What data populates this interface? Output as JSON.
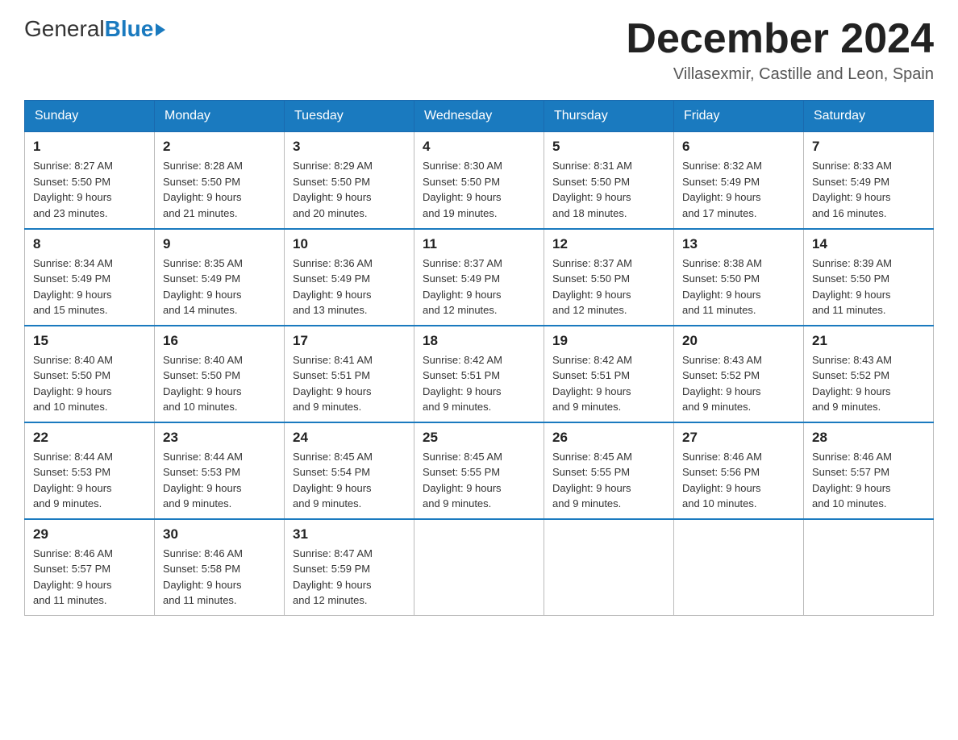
{
  "header": {
    "logo": {
      "general_text": "General",
      "blue_text": "Blue"
    },
    "title": "December 2024",
    "location": "Villasexmir, Castille and Leon, Spain"
  },
  "calendar": {
    "days_of_week": [
      "Sunday",
      "Monday",
      "Tuesday",
      "Wednesday",
      "Thursday",
      "Friday",
      "Saturday"
    ],
    "weeks": [
      [
        {
          "day": "1",
          "sunrise": "8:27 AM",
          "sunset": "5:50 PM",
          "daylight": "9 hours and 23 minutes."
        },
        {
          "day": "2",
          "sunrise": "8:28 AM",
          "sunset": "5:50 PM",
          "daylight": "9 hours and 21 minutes."
        },
        {
          "day": "3",
          "sunrise": "8:29 AM",
          "sunset": "5:50 PM",
          "daylight": "9 hours and 20 minutes."
        },
        {
          "day": "4",
          "sunrise": "8:30 AM",
          "sunset": "5:50 PM",
          "daylight": "9 hours and 19 minutes."
        },
        {
          "day": "5",
          "sunrise": "8:31 AM",
          "sunset": "5:50 PM",
          "daylight": "9 hours and 18 minutes."
        },
        {
          "day": "6",
          "sunrise": "8:32 AM",
          "sunset": "5:49 PM",
          "daylight": "9 hours and 17 minutes."
        },
        {
          "day": "7",
          "sunrise": "8:33 AM",
          "sunset": "5:49 PM",
          "daylight": "9 hours and 16 minutes."
        }
      ],
      [
        {
          "day": "8",
          "sunrise": "8:34 AM",
          "sunset": "5:49 PM",
          "daylight": "9 hours and 15 minutes."
        },
        {
          "day": "9",
          "sunrise": "8:35 AM",
          "sunset": "5:49 PM",
          "daylight": "9 hours and 14 minutes."
        },
        {
          "day": "10",
          "sunrise": "8:36 AM",
          "sunset": "5:49 PM",
          "daylight": "9 hours and 13 minutes."
        },
        {
          "day": "11",
          "sunrise": "8:37 AM",
          "sunset": "5:49 PM",
          "daylight": "9 hours and 12 minutes."
        },
        {
          "day": "12",
          "sunrise": "8:37 AM",
          "sunset": "5:50 PM",
          "daylight": "9 hours and 12 minutes."
        },
        {
          "day": "13",
          "sunrise": "8:38 AM",
          "sunset": "5:50 PM",
          "daylight": "9 hours and 11 minutes."
        },
        {
          "day": "14",
          "sunrise": "8:39 AM",
          "sunset": "5:50 PM",
          "daylight": "9 hours and 11 minutes."
        }
      ],
      [
        {
          "day": "15",
          "sunrise": "8:40 AM",
          "sunset": "5:50 PM",
          "daylight": "9 hours and 10 minutes."
        },
        {
          "day": "16",
          "sunrise": "8:40 AM",
          "sunset": "5:50 PM",
          "daylight": "9 hours and 10 minutes."
        },
        {
          "day": "17",
          "sunrise": "8:41 AM",
          "sunset": "5:51 PM",
          "daylight": "9 hours and 9 minutes."
        },
        {
          "day": "18",
          "sunrise": "8:42 AM",
          "sunset": "5:51 PM",
          "daylight": "9 hours and 9 minutes."
        },
        {
          "day": "19",
          "sunrise": "8:42 AM",
          "sunset": "5:51 PM",
          "daylight": "9 hours and 9 minutes."
        },
        {
          "day": "20",
          "sunrise": "8:43 AM",
          "sunset": "5:52 PM",
          "daylight": "9 hours and 9 minutes."
        },
        {
          "day": "21",
          "sunrise": "8:43 AM",
          "sunset": "5:52 PM",
          "daylight": "9 hours and 9 minutes."
        }
      ],
      [
        {
          "day": "22",
          "sunrise": "8:44 AM",
          "sunset": "5:53 PM",
          "daylight": "9 hours and 9 minutes."
        },
        {
          "day": "23",
          "sunrise": "8:44 AM",
          "sunset": "5:53 PM",
          "daylight": "9 hours and 9 minutes."
        },
        {
          "day": "24",
          "sunrise": "8:45 AM",
          "sunset": "5:54 PM",
          "daylight": "9 hours and 9 minutes."
        },
        {
          "day": "25",
          "sunrise": "8:45 AM",
          "sunset": "5:55 PM",
          "daylight": "9 hours and 9 minutes."
        },
        {
          "day": "26",
          "sunrise": "8:45 AM",
          "sunset": "5:55 PM",
          "daylight": "9 hours and 9 minutes."
        },
        {
          "day": "27",
          "sunrise": "8:46 AM",
          "sunset": "5:56 PM",
          "daylight": "9 hours and 10 minutes."
        },
        {
          "day": "28",
          "sunrise": "8:46 AM",
          "sunset": "5:57 PM",
          "daylight": "9 hours and 10 minutes."
        }
      ],
      [
        {
          "day": "29",
          "sunrise": "8:46 AM",
          "sunset": "5:57 PM",
          "daylight": "9 hours and 11 minutes."
        },
        {
          "day": "30",
          "sunrise": "8:46 AM",
          "sunset": "5:58 PM",
          "daylight": "9 hours and 11 minutes."
        },
        {
          "day": "31",
          "sunrise": "8:47 AM",
          "sunset": "5:59 PM",
          "daylight": "9 hours and 12 minutes."
        },
        null,
        null,
        null,
        null
      ]
    ],
    "labels": {
      "sunrise": "Sunrise:",
      "sunset": "Sunset:",
      "daylight": "Daylight:"
    }
  }
}
